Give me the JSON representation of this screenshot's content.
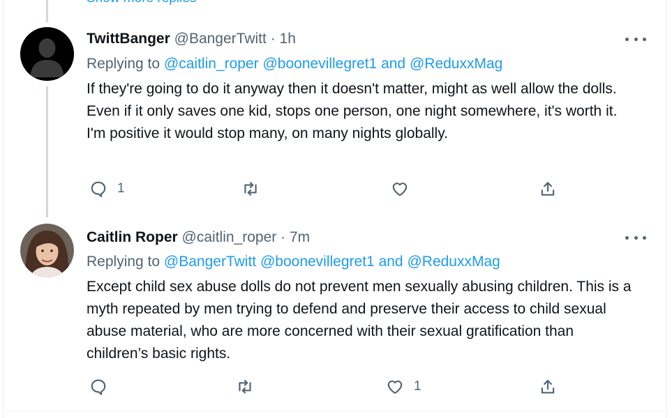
{
  "thread": {
    "show_more_label": "Show more replies"
  },
  "tweets": [
    {
      "display_name": "TwittBanger",
      "handle": "@BangerTwitt",
      "separator": "·",
      "time": "1h",
      "replying_prefix": "Replying to",
      "mentions": [
        "@caitlin_roper",
        "@boonevillegret1"
      ],
      "mention_and": "and",
      "mention_last": "@ReduxxMag",
      "text": "If they're going to do it anyway then it doesn't matter, might as well allow the dolls. Even if it only saves one kid, stops one person, one night somewhere, it's worth it. I'm positive it would stop many, on many nights globally.",
      "reply_count": "1",
      "retweet_count": "",
      "like_count": "",
      "avatar_icon": "default-silhouette-icon"
    },
    {
      "display_name": "Caitlin Roper",
      "handle": "@caitlin_roper",
      "separator": "·",
      "time": "7m",
      "replying_prefix": "Replying to",
      "mentions": [
        "@BangerTwitt",
        "@boonevillegret1"
      ],
      "mention_and": "and",
      "mention_last": "@ReduxxMag",
      "text": "Except child sex abuse dolls do not prevent men sexually abusing children. This is a myth repeated by men trying to defend and preserve their access to child sexual abuse material, who are more concerned with their sexual gratification than children’s basic rights.",
      "reply_count": "",
      "retweet_count": "",
      "like_count": "1",
      "avatar_icon": "profile-photo"
    }
  ],
  "colors": {
    "link": "#1d9bf0",
    "secondary": "#536471",
    "text": "#0f1419",
    "thread_line": "#cfd9de"
  }
}
